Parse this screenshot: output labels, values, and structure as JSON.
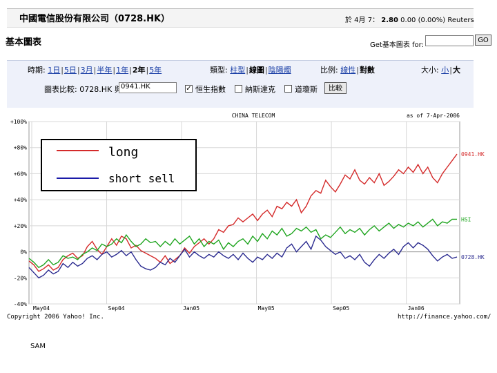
{
  "header": {
    "company": "中國電信股份有限公司（0728.HK）",
    "quote_prefix": "於 4月 7：",
    "price": "2.80",
    "change": "0.00 (0.00%)",
    "source": "Reuters"
  },
  "section_title": "基本圖表",
  "get_chart": {
    "label": "Get基本圖表 for:",
    "value": "",
    "button": "GO"
  },
  "controls": {
    "period_label": "時期:",
    "periods": [
      "1日",
      "5日",
      "3月",
      "半年",
      "1年",
      "2年",
      "5年"
    ],
    "period_selected": "2年",
    "type_label": "類型:",
    "types": [
      "柱型",
      "線圖",
      "陰陽燭"
    ],
    "type_selected": "線圖",
    "scale_label": "比例:",
    "scales": [
      "線性",
      "對數"
    ],
    "scale_selected": "對數",
    "size_label": "大小:",
    "sizes": [
      "小",
      "大"
    ],
    "size_selected": "大",
    "compare_label": "圖表比較:",
    "compare_symbol": "0728.HK 與",
    "compare_value": "0941.HK",
    "checks": [
      {
        "label": "恒生指數",
        "checked": true
      },
      {
        "label": "納斯達克",
        "checked": false
      },
      {
        "label": "道瓊斯",
        "checked": false
      }
    ],
    "compare_button": "比較"
  },
  "chart_data": {
    "type": "line",
    "title": "CHINA TELECOM",
    "date_note": "as of 7-Apr-2006",
    "yticks": [
      "+100%",
      "+80%",
      "+60%",
      "+40%",
      "+20%",
      "0%",
      "-20%",
      "-40%"
    ],
    "ylim": [
      -40,
      100
    ],
    "xticks": [
      "May04",
      "Sep04",
      "Jan05",
      "May05",
      "Sep05",
      "Jan06"
    ],
    "grid": true,
    "series": [
      {
        "name": "0941.HK",
        "color": "#d42a2a",
        "values": [
          -7,
          -10,
          -15,
          -13,
          -10,
          -14,
          -12,
          -6,
          -3,
          -1,
          -5,
          -3,
          4,
          8,
          2,
          -2,
          4,
          10,
          5,
          12,
          10,
          3,
          5,
          1,
          -1,
          -3,
          -5,
          -8,
          -3,
          -9,
          -6,
          -3,
          3,
          -1,
          4,
          7,
          10,
          6,
          10,
          17,
          15,
          20,
          21,
          26,
          23,
          26,
          29,
          24,
          29,
          32,
          27,
          35,
          33,
          38,
          35,
          40,
          30,
          35,
          43,
          47,
          45,
          55,
          50,
          46,
          52,
          59,
          56,
          63,
          55,
          52,
          57,
          53,
          60,
          51,
          54,
          58,
          63,
          60,
          65,
          61,
          67,
          60,
          65,
          57,
          53,
          60,
          65,
          70,
          75
        ]
      },
      {
        "name": "HSI",
        "color": "#1fa51f",
        "values": [
          -5,
          -8,
          -12,
          -10,
          -6,
          -10,
          -8,
          -3,
          -5,
          -4,
          -6,
          -2,
          0,
          3,
          1,
          6,
          4,
          6,
          10,
          7,
          13,
          8,
          4,
          6,
          10,
          7,
          8,
          4,
          8,
          5,
          10,
          6,
          9,
          12,
          6,
          10,
          4,
          8,
          6,
          9,
          2,
          7,
          4,
          8,
          10,
          6,
          12,
          8,
          14,
          10,
          16,
          13,
          18,
          12,
          14,
          18,
          16,
          19,
          15,
          17,
          10,
          13,
          11,
          15,
          19,
          14,
          17,
          15,
          18,
          13,
          17,
          20,
          16,
          19,
          22,
          18,
          21,
          19,
          22,
          20,
          23,
          19,
          22,
          25,
          20,
          23,
          22,
          25,
          25
        ]
      },
      {
        "name": "0728.HK",
        "color": "#2a2a8f",
        "values": [
          -12,
          -16,
          -20,
          -18,
          -14,
          -17,
          -15,
          -9,
          -12,
          -8,
          -11,
          -9,
          -5,
          -3,
          -6,
          -2,
          0,
          -4,
          -2,
          1,
          -3,
          0,
          -6,
          -11,
          -13,
          -14,
          -12,
          -8,
          -10,
          -5,
          -8,
          -3,
          2,
          -4,
          0,
          -3,
          -5,
          -2,
          -4,
          0,
          -3,
          -5,
          -2,
          -6,
          -1,
          -5,
          -8,
          -4,
          -6,
          -2,
          -5,
          -1,
          -4,
          3,
          6,
          0,
          4,
          8,
          2,
          12,
          9,
          4,
          1,
          -2,
          0,
          -5,
          -3,
          -6,
          -2,
          -8,
          -11,
          -6,
          -2,
          -5,
          -1,
          2,
          -2,
          4,
          7,
          3,
          7,
          5,
          2,
          -3,
          -7,
          -4,
          -2,
          -5,
          -4
        ]
      }
    ]
  },
  "legend_box": {
    "long_label": "long",
    "short_label": "short sell",
    "long_color": "#d42a2a",
    "short_color": "#1a1aa8"
  },
  "footer": {
    "copyright": "Copyright 2006 Yahoo! Inc.",
    "url": "http://finance.yahoo.com/"
  },
  "note": "SAM"
}
